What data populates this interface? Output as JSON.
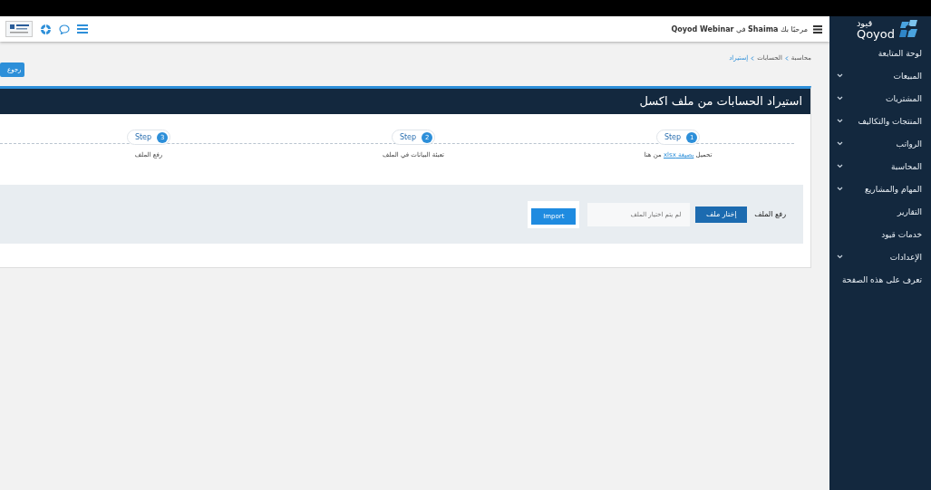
{
  "header": {
    "welcome": "مرحبًا بك **Shaima** في **Qoyod Webinar**"
  },
  "sidebar": {
    "logo_arabic": "قيود",
    "logo_latin": "Qoyod",
    "items": [
      {
        "label": "لوحة المتابعة",
        "has_submenu": false
      },
      {
        "label": "المبيعات",
        "has_submenu": true
      },
      {
        "label": "المشتريات",
        "has_submenu": true
      },
      {
        "label": "المنتجات والتكاليف",
        "has_submenu": true
      },
      {
        "label": "الرواتب",
        "has_submenu": true
      },
      {
        "label": "المحاسبة",
        "has_submenu": true
      },
      {
        "label": "المهام والمشاريع",
        "has_submenu": true
      },
      {
        "label": "التقارير",
        "has_submenu": false
      },
      {
        "label": "خدمات قيود",
        "has_submenu": false
      },
      {
        "label": "الإعدادات",
        "has_submenu": true
      },
      {
        "label": "تعرف على هذه الصفحة",
        "has_submenu": false
      }
    ]
  },
  "breadcrumb": [
    "محاسبة",
    "الحسابات",
    "إستيراد"
  ],
  "back_button": "رجوع",
  "card": {
    "title": "استيراد الحسابات من ملف اكسل",
    "steps": [
      {
        "label": "Step",
        "number": "1",
        "caption_before": "تحميل ",
        "caption_link": "بصيغة xlsx",
        "caption_after": " من هنا"
      },
      {
        "label": "Step",
        "number": "2",
        "caption_before": "تعبئة البيانات في الملف"
      },
      {
        "label": "Step",
        "number": "3",
        "caption_before": "رفع الملف"
      }
    ],
    "upload": {
      "label": "رفع الملف",
      "choose_button": "إختار ملف",
      "placeholder": "لم يتم اختيار الملف",
      "import_button": "Import"
    }
  }
}
